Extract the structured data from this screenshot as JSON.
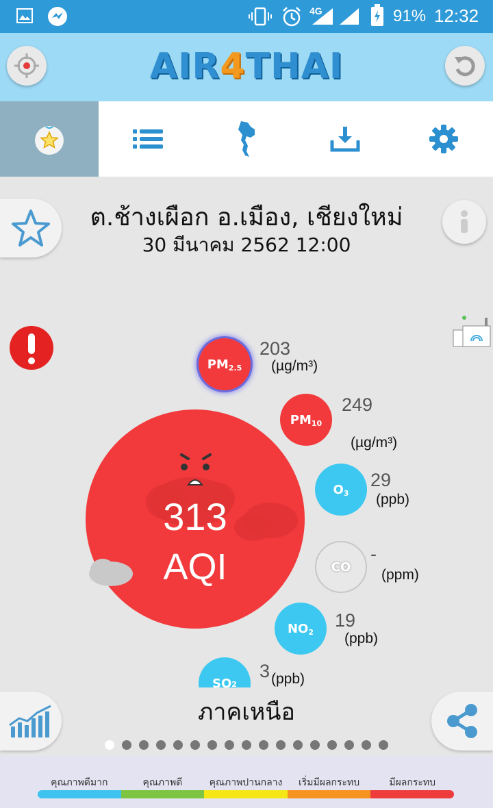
{
  "status_bar": {
    "network": "4G",
    "battery": "91%",
    "time": "12:32"
  },
  "header": {
    "logo_part1": "AIR",
    "logo_part2": "4",
    "logo_part3": "THAI"
  },
  "tabs": [
    {
      "name": "favorites",
      "active": true
    },
    {
      "name": "list",
      "active": false
    },
    {
      "name": "thailand-map",
      "active": false
    },
    {
      "name": "download",
      "active": false
    },
    {
      "name": "settings",
      "active": false
    }
  ],
  "station": {
    "location": "ต.ช้างเผือก อ.เมือง, เชียงใหม่",
    "datetime": "30 มีนาคม 2562 12:00"
  },
  "aqi": {
    "value": "313",
    "label": "AQI",
    "color": "#f23a3c"
  },
  "pollutants": {
    "pm25": {
      "label": "PM",
      "sub": "2.5",
      "value": "203",
      "unit": "(µg/m³)",
      "color": "#f23a3c"
    },
    "pm10": {
      "label": "PM",
      "sub": "10",
      "value": "249",
      "unit": "(µg/m³)",
      "color": "#f23a3c"
    },
    "o3": {
      "label": "O",
      "sub": "3",
      "value": "29",
      "unit": "(ppb)",
      "color": "#3cc8f0"
    },
    "co": {
      "label": "CO",
      "value": "-",
      "unit": "(ppm)",
      "color": "#e8e8e8"
    },
    "no2": {
      "label": "NO",
      "sub": "2",
      "value": "19",
      "unit": "(ppb)",
      "color": "#3cc8f0"
    },
    "so2": {
      "label": "SO",
      "sub": "2",
      "value": "3",
      "unit": "(ppb)",
      "color": "#3cc8f0"
    }
  },
  "region": "ภาคเหนือ",
  "pager": {
    "current_index": 0,
    "count": 17
  },
  "legend": [
    {
      "label": "คุณภาพดีมาก",
      "color": "#3ec3ee"
    },
    {
      "label": "คุณภาพดี",
      "color": "#7cc442"
    },
    {
      "label": "คุณภาพปานกลาง",
      "color": "#f5e615"
    },
    {
      "label": "เริ่มมีผลกระทบ",
      "color": "#f79320"
    },
    {
      "label": "มีผลกระทบ",
      "color": "#ee3b3b"
    }
  ]
}
